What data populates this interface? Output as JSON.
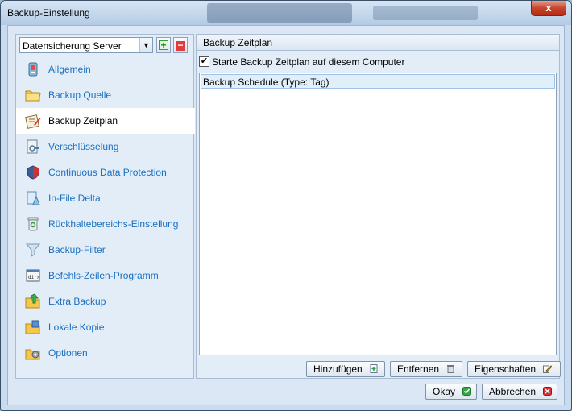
{
  "window": {
    "title": "Backup-Einstellung",
    "close_label": "x"
  },
  "selector": {
    "value": "Datensicherung Server",
    "add_label": "+",
    "remove_label": "−"
  },
  "nav": {
    "items": [
      {
        "label": "Allgemein",
        "icon": "general-icon"
      },
      {
        "label": "Backup Quelle",
        "icon": "folder-icon"
      },
      {
        "label": "Backup Zeitplan",
        "icon": "schedule-icon",
        "active": true
      },
      {
        "label": "Verschlüsselung",
        "icon": "encryption-icon"
      },
      {
        "label": "Continuous Data Protection",
        "icon": "shield-icon"
      },
      {
        "label": "In-File Delta",
        "icon": "delta-icon"
      },
      {
        "label": "Rückhaltebereichs-Einstellung",
        "icon": "recycle-bin-icon"
      },
      {
        "label": "Backup-Filter",
        "icon": "filter-icon"
      },
      {
        "label": "Befehls-Zeilen-Programm",
        "icon": "command-line-icon"
      },
      {
        "label": "Extra Backup",
        "icon": "extra-backup-icon"
      },
      {
        "label": "Lokale Kopie",
        "icon": "local-copy-icon"
      },
      {
        "label": "Optionen",
        "icon": "options-icon"
      }
    ]
  },
  "panel": {
    "title": "Backup Zeitplan",
    "checkbox_label": "Starte Backup Zeitplan auf diesem Computer",
    "checkbox_checked": true,
    "list": [
      {
        "label": "Backup Schedule (Type: Tag)"
      }
    ],
    "buttons": {
      "add": "Hinzufügen",
      "remove": "Entfernen",
      "properties": "Eigenschaften"
    }
  },
  "footer": {
    "ok": "Okay",
    "cancel": "Abbrechen"
  },
  "colors": {
    "link": "#1a6fc0",
    "panel_bg": "#e3edf8",
    "selection": "#e1effb"
  }
}
